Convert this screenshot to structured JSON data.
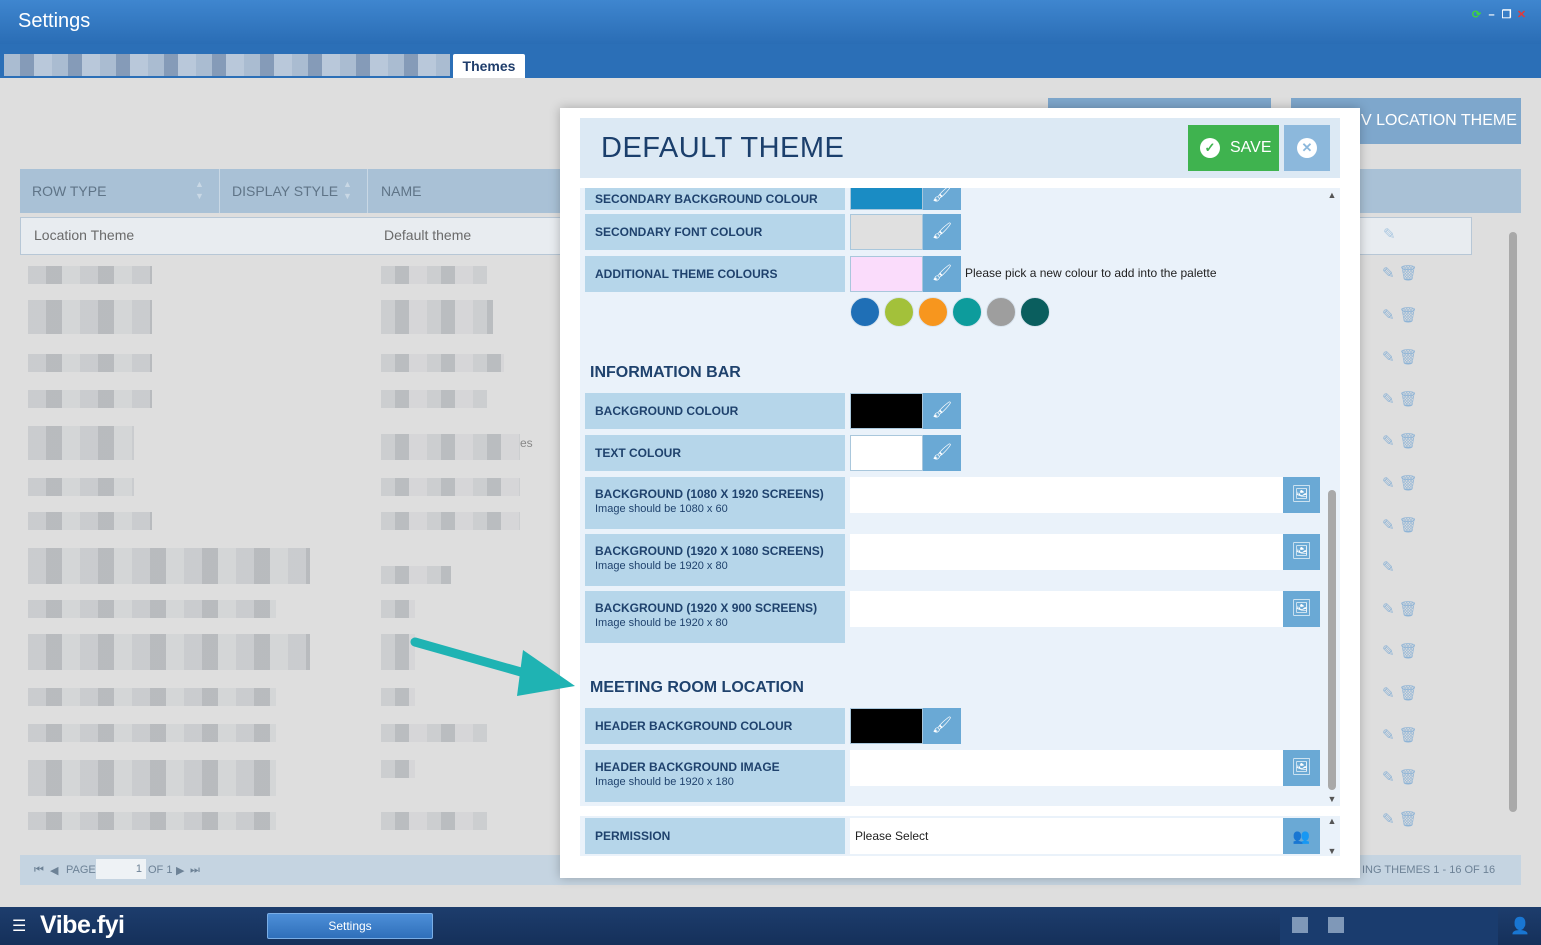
{
  "window": {
    "title": "Settings"
  },
  "tabs": {
    "active_label": "Themes"
  },
  "background": {
    "add_location_theme_fragment": "V LOCATION THEME",
    "grid_columns": [
      "ROW TYPE",
      "DISPLAY STYLE",
      "NAME"
    ],
    "first_row": {
      "row_type": "Location Theme",
      "name": "Default theme"
    },
    "stray_text": "es",
    "pager": {
      "page_label": "PAGE",
      "page_value": "1",
      "of_label": "OF 1",
      "summary": "ING THEMES 1 - 16 OF 16"
    }
  },
  "modal": {
    "title": "DEFAULT THEME",
    "save_label": "SAVE",
    "rows": {
      "secondary_bg": "SECONDARY BACKGROUND COLOUR",
      "secondary_font": "SECONDARY FONT COLOUR",
      "additional_colours": "ADDITIONAL THEME COLOURS",
      "palette_hint": "Please pick a new colour to add into the palette",
      "info_bar_section": "INFORMATION BAR",
      "info_bg_colour": "BACKGROUND COLOUR",
      "info_text_colour": "TEXT COLOUR",
      "bg_1080x1920": "BACKGROUND (1080 X 1920 SCREENS)",
      "bg_1080x1920_hint": "Image should be 1080 x 60",
      "bg_1920x1080": "BACKGROUND (1920 X 1080 SCREENS)",
      "bg_1920x1080_hint": "Image should be 1920 x 80",
      "bg_1920x900": "BACKGROUND (1920 X 900 SCREENS)",
      "bg_1920x900_hint": "Image should be 1920 x 80",
      "meeting_section": "MEETING ROOM LOCATION",
      "header_bg_colour": "HEADER BACKGROUND COLOUR",
      "header_bg_image": "HEADER BACKGROUND IMAGE",
      "header_bg_image_hint": "Image should be 1920 x 180",
      "permission": "PERMISSION",
      "permission_value": "Please Select"
    },
    "colours": {
      "secondary_bg": "#1a8cc4",
      "secondary_font": "#e0e0e0",
      "additional": "#fadcfb",
      "info_bg": "#000000",
      "info_text": "#ffffff",
      "header_bg": "#000000"
    },
    "palette": [
      "#1f6fb6",
      "#a3c13a",
      "#f7961e",
      "#0d9c9c",
      "#9e9e9e",
      "#0a5e5e"
    ]
  },
  "taskbar": {
    "logo": "Vibe.fyi",
    "task_button": "Settings"
  },
  "icons": {
    "brush": "paint-brush-icon",
    "image": "image-icon",
    "users": "users-icon",
    "save": "check-circle-icon",
    "close": "close-circle-icon"
  }
}
